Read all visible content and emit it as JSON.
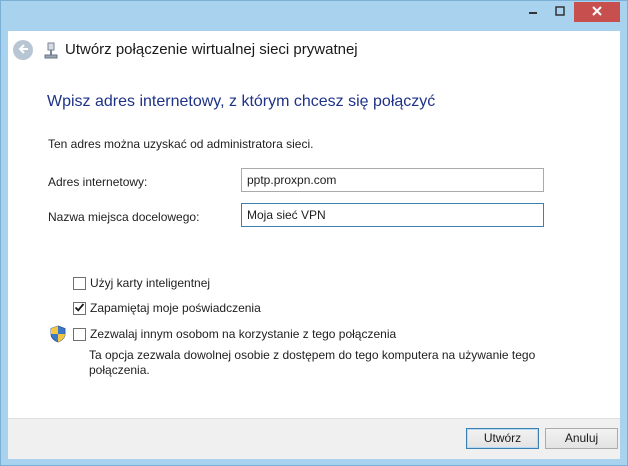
{
  "window": {
    "title": "Utwórz połączenie wirtualnej sieci prywatnej",
    "accent": "#a9d2ee",
    "close_color": "#c7504e"
  },
  "caption_buttons": {
    "minimize_icon": "minimize-icon",
    "maximize_icon": "maximize-icon",
    "close_icon": "close-icon"
  },
  "main": {
    "instruction": "Wpisz adres internetowy, z którym chcesz się połączyć",
    "info": "Ten adres można uzyskać od administratora sieci.",
    "address_label": "Adres internetowy:",
    "address_value": "pptp.proxpn.com",
    "destination_label": "Nazwa miejsca docelowego:",
    "destination_value": "Moja sieć VPN",
    "smart_card_label": "Użyj karty inteligentnej",
    "smart_card_checked": false,
    "remember_label": "Zapamiętaj moje poświadczenia",
    "remember_checked": true,
    "allow_others_label": "Zezwalaj innym osobom na korzystanie z tego połączenia",
    "allow_others_checked": false,
    "allow_others_note": "Ta opcja zezwala dowolnej osobie z dostępem do tego komputera na używanie tego połączenia."
  },
  "footer": {
    "create_label": "Utwórz",
    "cancel_label": "Anuluj"
  }
}
